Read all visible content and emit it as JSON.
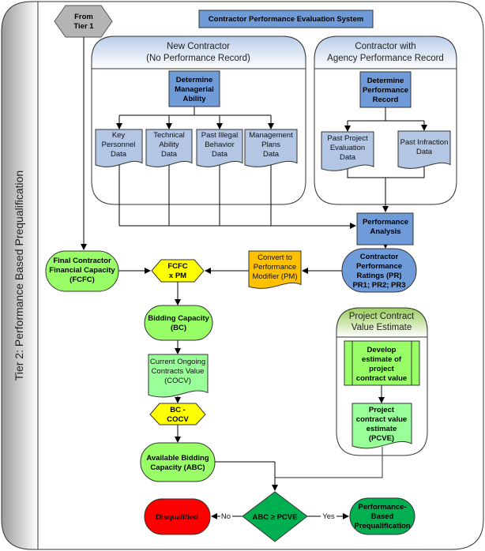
{
  "lane": {
    "title": "Tier 2: Performance Based Prequalification"
  },
  "system_title": "Contractor Performance Evaluation System",
  "from_tier": [
    "From",
    "Tier 1"
  ],
  "pools": {
    "new_contractor": [
      "New Contractor",
      "(No Performance Record)"
    ],
    "agency_record": [
      "Contractor with",
      "Agency Performance Record"
    ],
    "project_estimate": [
      "Project Contract",
      "Value Estimate"
    ]
  },
  "nodes": {
    "managerial": [
      "Determine",
      "Managerial",
      "Ability"
    ],
    "key_personnel": [
      "Key",
      "Personnel",
      "Data"
    ],
    "technical": [
      "Technical",
      "Ability",
      "Data"
    ],
    "illegal": [
      "Past Illegal",
      "Behavior",
      "Data"
    ],
    "management_plans": [
      "Management",
      "Plans",
      "Data"
    ],
    "perf_record": [
      "Determine",
      "Performance",
      "Record"
    ],
    "past_project": [
      "Past Project",
      "Evaluation",
      "Data"
    ],
    "past_infraction": [
      "Past Infraction",
      "Data"
    ],
    "perf_analysis": [
      "Performance",
      "Analysis"
    ],
    "fcfc": [
      "Final Contractor",
      "Financial Capacity",
      "(FCFC)"
    ],
    "fcfc_pm": [
      "FCFC",
      "x PM"
    ],
    "convert_pm": [
      "Convert to",
      "Performance",
      "Modifier (PM)"
    ],
    "ratings": [
      "Contractor",
      "Performance",
      "Ratings (PR)",
      "PR1; PR2; PR3"
    ],
    "bidding": [
      "Bidding Capacity",
      "(BC)"
    ],
    "cocv": [
      "Current Ongoing",
      "Contracts Value",
      "(COCV)"
    ],
    "bc_cocv": [
      "BC -",
      "COCV"
    ],
    "abc": [
      "Available Bidding",
      "Capacity (ABC)"
    ],
    "develop": [
      "Develop",
      "estimate of",
      "project",
      "contract value"
    ],
    "pcve": [
      "Project",
      "contract value",
      "estimate",
      "(PCVE)"
    ],
    "decision": "ABC ≥  PCVE",
    "disqualified": "Disqualified",
    "prequalified": [
      "Performance-",
      "Based",
      "Prequalification"
    ]
  },
  "edge_labels": {
    "no": "No",
    "yes": "Yes"
  },
  "colors": {
    "blue": "#6f9bd8",
    "doc_blue": "#b3c6e3",
    "green_light": "#99ff66",
    "green_doc": "#99ff99",
    "green_dark": "#00b050",
    "yellow": "#ffff00",
    "orange": "#ffc000",
    "red": "#ff0000",
    "gray": "#b4b4b4"
  }
}
